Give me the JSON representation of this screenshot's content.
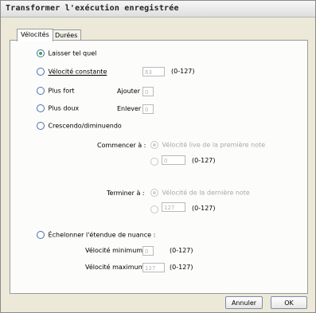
{
  "window": {
    "title": "Transformer l'exécution enregistrée"
  },
  "tabs": [
    {
      "label": "Vélocités",
      "active": true
    },
    {
      "label": "Durées",
      "active": false
    }
  ],
  "options": {
    "leave": {
      "label": "Laisser tel quel",
      "selected": true
    },
    "constant": {
      "label": "Vélocité constante",
      "value": "63",
      "range": "(0-127)"
    },
    "louder": {
      "label": "Plus fort",
      "sub_label": "Ajouter",
      "value": "0"
    },
    "softer": {
      "label": "Plus doux",
      "sub_label": "Enlever",
      "value": "0"
    },
    "crescendo": {
      "label": "Crescendo/diminuendo",
      "start_label": "Commencer à :",
      "start_option": "Vélocité live de la première note",
      "start_value": "0",
      "start_range": "(0-127)",
      "end_label": "Terminer à :",
      "end_option": "Vélocité de la dernière note",
      "end_value": "127",
      "end_range": "(0-127)"
    },
    "scale": {
      "label": "Échelonner l'étendue de nuance :",
      "min_label": "Vélocité minimum",
      "min_value": "0",
      "min_range": "(0-127)",
      "max_label": "Vélocité maximum",
      "max_value": "127",
      "max_range": "(0-127)"
    }
  },
  "buttons": {
    "cancel": "Annuler",
    "ok": "OK"
  },
  "colors": {
    "radio_selected": "#3aaa35",
    "window_bg": "#ece9d8",
    "panel_bg": "#fcfcfb"
  }
}
